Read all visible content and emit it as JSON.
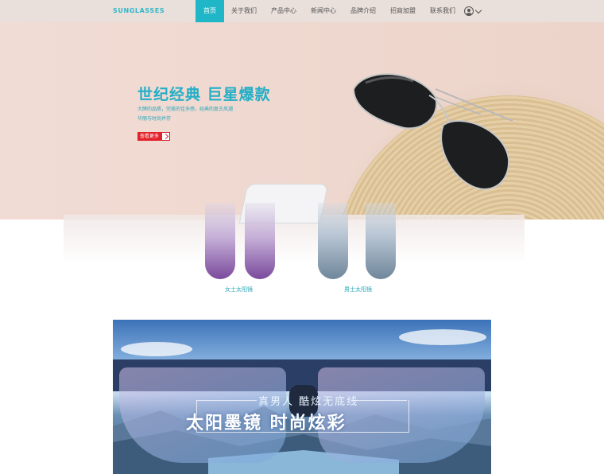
{
  "nav": {
    "logo": "SUNGLASSES",
    "items": [
      {
        "label": "首页",
        "active": true
      },
      {
        "label": "关于我们"
      },
      {
        "label": "产品中心"
      },
      {
        "label": "新闻中心"
      },
      {
        "label": "品牌介绍"
      },
      {
        "label": "招商加盟"
      },
      {
        "label": "联系我们"
      }
    ]
  },
  "hero": {
    "title": "世纪经典 巨星爆款",
    "desc_line1": "大牌的品质，完美的佳多感，经典的复古风潮",
    "desc_line2": "华丽与时尚并存",
    "button": "查看更多"
  },
  "products": {
    "women_label": "女士太阳镜",
    "men_label": "男士太阳镜"
  },
  "banner": {
    "slogan_top": "真男人 酷炫无底线",
    "slogan_main": "太阳墨镜 时尚炫彩"
  },
  "colors": {
    "accent": "#1fb6c8",
    "button_red": "#e2222b",
    "nav_bg": "#e9dfdb",
    "hero_bg": "#efd8cf"
  }
}
